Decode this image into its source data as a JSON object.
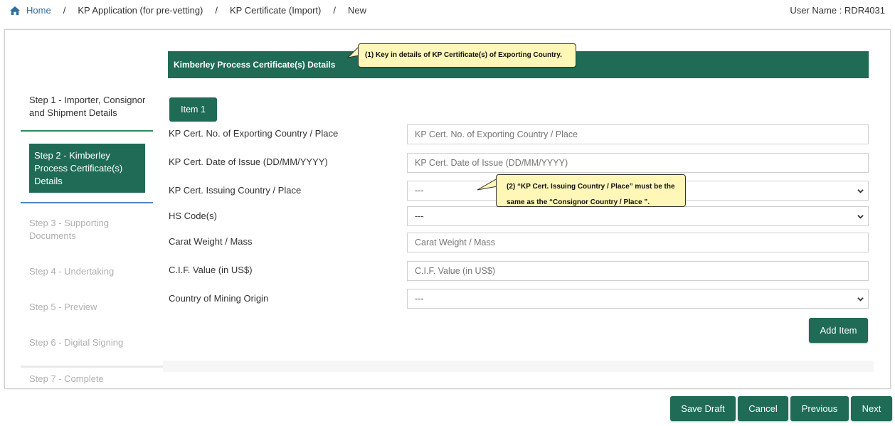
{
  "breadcrumb": {
    "home": "Home",
    "items": [
      "KP Application (for pre-vetting)",
      "KP Certificate (Import)",
      "New"
    ],
    "separator": "/"
  },
  "user": {
    "label": "User Name : RDR4031"
  },
  "steps": [
    "Step 1 - Importer, Consignor and Shipment Details",
    "Step 2 - Kimberley Process Certificate(s) Details",
    "Step 3 - Supporting Documents",
    "Step 4 - Undertaking",
    "Step 5 - Preview",
    "Step 6 - Digital Signing",
    "Step 7 - Complete"
  ],
  "section": {
    "title": "Kimberley Process Certificate(s) Details"
  },
  "item_tab": "Item 1",
  "form": {
    "cert_no": {
      "label": "KP Cert. No. of Exporting Country / Place",
      "placeholder": "KP Cert. No. of Exporting Country / Place"
    },
    "cert_date": {
      "label": "KP Cert. Date of Issue (DD/MM/YYYY)",
      "placeholder": "KP Cert. Date of Issue (DD/MM/YYYY)"
    },
    "issuing_country": {
      "label": "KP Cert. Issuing Country / Place",
      "value": "---"
    },
    "hs_code": {
      "label": "HS Code(s)",
      "value": "---"
    },
    "carat": {
      "label": "Carat Weight / Mass",
      "placeholder": "Carat Weight / Mass"
    },
    "cif": {
      "label": "C.I.F. Value (in US$)",
      "placeholder": "C.I.F. Value (in US$)"
    },
    "mining_origin": {
      "label": "Country of Mining Origin",
      "value": "---"
    }
  },
  "buttons": {
    "add_item": "Add Item",
    "save_draft": "Save Draft",
    "cancel": "Cancel",
    "previous": "Previous",
    "next": "Next"
  },
  "callouts": {
    "one": "(1) Key in details of KP Certificate(s) of Exporting Country.",
    "two_line1": "(2) “KP Cert. Issuing Country  / Place” must be the",
    "two_line2": "same as the “Consignor  Country  / Place ”."
  },
  "colors": {
    "primary": "#1f6b55",
    "link": "#2f6f9f",
    "callout_bg": "#fff7b8"
  }
}
